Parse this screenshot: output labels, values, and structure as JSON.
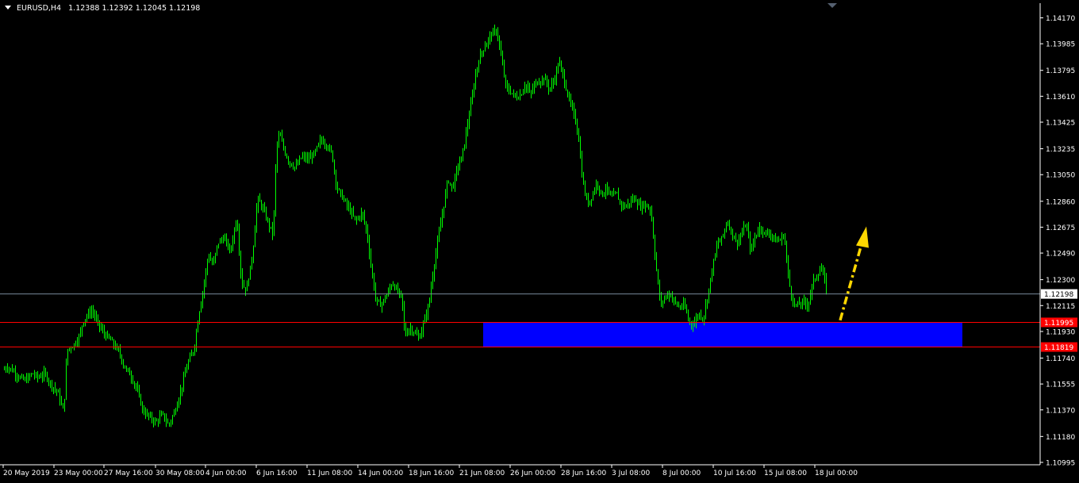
{
  "header": {
    "symbol": "EURUSD,H4",
    "ohlc": "1.12388 1.12392 1.12045 1.12198"
  },
  "colors": {
    "background": "#000000",
    "candle": "#00ff00",
    "grid_axis": "#ffffff",
    "zone_fill": "#0000ff",
    "support_line": "#ff0000",
    "arrow": "#ffd700",
    "price_line": "#778899"
  },
  "chart_data": {
    "type": "candlestick",
    "symbol": "EURUSD",
    "timeframe": "H4",
    "ylim": [
      1.10995,
      1.1426
    ],
    "y_ticks": [
      "1.14170",
      "1.13985",
      "1.13795",
      "1.13610",
      "1.13425",
      "1.13235",
      "1.13050",
      "1.12860",
      "1.12675",
      "1.12490",
      "1.12300",
      "1.12115",
      "1.11930",
      "1.11740",
      "1.11555",
      "1.11370",
      "1.11180",
      "1.10995"
    ],
    "x_ticks": [
      "20 May 2019",
      "23 May 00:00",
      "27 May 16:00",
      "30 May 08:00",
      "4 Jun 00:00",
      "6 Jun 16:00",
      "11 Jun 08:00",
      "14 Jun 00:00",
      "18 Jun 16:00",
      "21 Jun 08:00",
      "26 Jun 00:00",
      "28 Jun 16:00",
      "3 Jul 08:00",
      "8 Jul 00:00",
      "10 Jul 16:00",
      "15 Jul 08:00",
      "18 Jul 00:00"
    ],
    "current_price": "1.12198",
    "levels": [
      {
        "price": "1.11995",
        "label": "1.11995",
        "color": "#ff0000"
      },
      {
        "price": "1.11819",
        "label": "1.11819",
        "color": "#ff0000"
      }
    ],
    "zone": {
      "low": 1.11819,
      "high": 1.11995,
      "from": "21 Jun 08:00",
      "to": "after 18 Jul 00:00",
      "color": "#0000ff"
    },
    "arrow": {
      "direction": "up",
      "from_price": 1.1201,
      "to_price": 1.1268,
      "color": "#ffd700",
      "style": "dash-dot"
    },
    "close_path": [
      [
        0,
        1.1162
      ],
      [
        8,
        1.1168
      ],
      [
        16,
        1.1165
      ],
      [
        24,
        1.116
      ],
      [
        32,
        1.1158
      ],
      [
        40,
        1.1163
      ],
      [
        48,
        1.116
      ],
      [
        56,
        1.1163
      ],
      [
        64,
        1.1155
      ],
      [
        72,
        1.115
      ],
      [
        80,
        1.1135
      ],
      [
        84,
        1.118
      ],
      [
        92,
        1.1183
      ],
      [
        100,
        1.119
      ],
      [
        104,
        1.12
      ],
      [
        110,
        1.1205
      ],
      [
        116,
        1.1208
      ],
      [
        122,
        1.12
      ],
      [
        130,
        1.1192
      ],
      [
        140,
        1.1186
      ],
      [
        150,
        1.1178
      ],
      [
        156,
        1.1168
      ],
      [
        164,
        1.1162
      ],
      [
        172,
        1.1152
      ],
      [
        180,
        1.1136
      ],
      [
        188,
        1.1132
      ],
      [
        196,
        1.1128
      ],
      [
        204,
        1.1134
      ],
      [
        212,
        1.1126
      ],
      [
        220,
        1.1136
      ],
      [
        228,
        1.1152
      ],
      [
        236,
        1.117
      ],
      [
        244,
        1.118
      ],
      [
        250,
        1.1205
      ],
      [
        256,
        1.1224
      ],
      [
        262,
        1.1248
      ],
      [
        268,
        1.124
      ],
      [
        274,
        1.1256
      ],
      [
        282,
        1.126
      ],
      [
        290,
        1.125
      ],
      [
        298,
        1.1275
      ],
      [
        304,
        1.1228
      ],
      [
        310,
        1.1222
      ],
      [
        318,
        1.1248
      ],
      [
        324,
        1.1288
      ],
      [
        330,
        1.1282
      ],
      [
        338,
        1.127
      ],
      [
        344,
        1.1262
      ],
      [
        348,
        1.1325
      ],
      [
        352,
        1.1334
      ],
      [
        358,
        1.1322
      ],
      [
        364,
        1.1314
      ],
      [
        372,
        1.131
      ],
      [
        380,
        1.1318
      ],
      [
        388,
        1.1316
      ],
      [
        396,
        1.132
      ],
      [
        404,
        1.133
      ],
      [
        412,
        1.1326
      ],
      [
        418,
        1.132
      ],
      [
        424,
        1.1296
      ],
      [
        432,
        1.1288
      ],
      [
        440,
        1.128
      ],
      [
        448,
        1.1272
      ],
      [
        456,
        1.1278
      ],
      [
        462,
        1.1264
      ],
      [
        468,
        1.1236
      ],
      [
        474,
        1.1214
      ],
      [
        480,
        1.1212
      ],
      [
        488,
        1.122
      ],
      [
        494,
        1.1228
      ],
      [
        500,
        1.1222
      ],
      [
        506,
        1.1218
      ],
      [
        510,
        1.119
      ],
      [
        516,
        1.1196
      ],
      [
        522,
        1.1192
      ],
      [
        528,
        1.1188
      ],
      [
        534,
        1.12
      ],
      [
        540,
        1.1212
      ],
      [
        546,
        1.1238
      ],
      [
        552,
        1.126
      ],
      [
        558,
        1.128
      ],
      [
        564,
        1.1302
      ],
      [
        570,
        1.1295
      ],
      [
        576,
        1.131
      ],
      [
        582,
        1.1318
      ],
      [
        588,
        1.1338
      ],
      [
        594,
        1.1358
      ],
      [
        600,
        1.138
      ],
      [
        606,
        1.1392
      ],
      [
        612,
        1.1398
      ],
      [
        618,
        1.1405
      ],
      [
        626,
        1.1408
      ],
      [
        632,
        1.1386
      ],
      [
        638,
        1.1366
      ],
      [
        644,
        1.1364
      ],
      [
        650,
        1.136
      ],
      [
        656,
        1.1362
      ],
      [
        662,
        1.137
      ],
      [
        668,
        1.1362
      ],
      [
        674,
        1.137
      ],
      [
        680,
        1.1372
      ],
      [
        686,
        1.1374
      ],
      [
        692,
        1.1366
      ],
      [
        698,
        1.1372
      ],
      [
        704,
        1.1386
      ],
      [
        710,
        1.1374
      ],
      [
        716,
        1.136
      ],
      [
        722,
        1.135
      ],
      [
        728,
        1.1336
      ],
      [
        734,
        1.13
      ],
      [
        740,
        1.1284
      ],
      [
        746,
        1.129
      ],
      [
        752,
        1.13
      ],
      [
        758,
        1.129
      ],
      [
        764,
        1.1296
      ],
      [
        770,
        1.1288
      ],
      [
        776,
        1.1292
      ],
      [
        782,
        1.1284
      ],
      [
        788,
        1.1282
      ],
      [
        794,
        1.1286
      ],
      [
        800,
        1.1288
      ],
      [
        806,
        1.1282
      ],
      [
        812,
        1.1284
      ],
      [
        820,
        1.128
      ],
      [
        826,
        1.1242
      ],
      [
        832,
        1.1212
      ],
      [
        838,
        1.1218
      ],
      [
        844,
        1.122
      ],
      [
        850,
        1.1214
      ],
      [
        856,
        1.121
      ],
      [
        862,
        1.1212
      ],
      [
        868,
        1.12
      ],
      [
        874,
        1.1198
      ],
      [
        880,
        1.1206
      ],
      [
        886,
        1.1202
      ],
      [
        892,
        1.122
      ],
      [
        898,
        1.124
      ],
      [
        904,
        1.1256
      ],
      [
        910,
        1.126
      ],
      [
        916,
        1.1272
      ],
      [
        922,
        1.1264
      ],
      [
        928,
        1.1256
      ],
      [
        934,
        1.1262
      ],
      [
        940,
        1.127
      ],
      [
        946,
        1.125
      ],
      [
        952,
        1.1262
      ],
      [
        958,
        1.1268
      ],
      [
        964,
        1.1262
      ],
      [
        970,
        1.1264
      ],
      [
        976,
        1.1258
      ],
      [
        982,
        1.1258
      ],
      [
        988,
        1.1262
      ],
      [
        994,
        1.1228
      ],
      [
        1000,
        1.1212
      ],
      [
        1006,
        1.1212
      ],
      [
        1012,
        1.1214
      ],
      [
        1018,
        1.1212
      ],
      [
        1024,
        1.1228
      ],
      [
        1030,
        1.1234
      ],
      [
        1036,
        1.1238
      ],
      [
        1042,
        1.122
      ]
    ]
  }
}
